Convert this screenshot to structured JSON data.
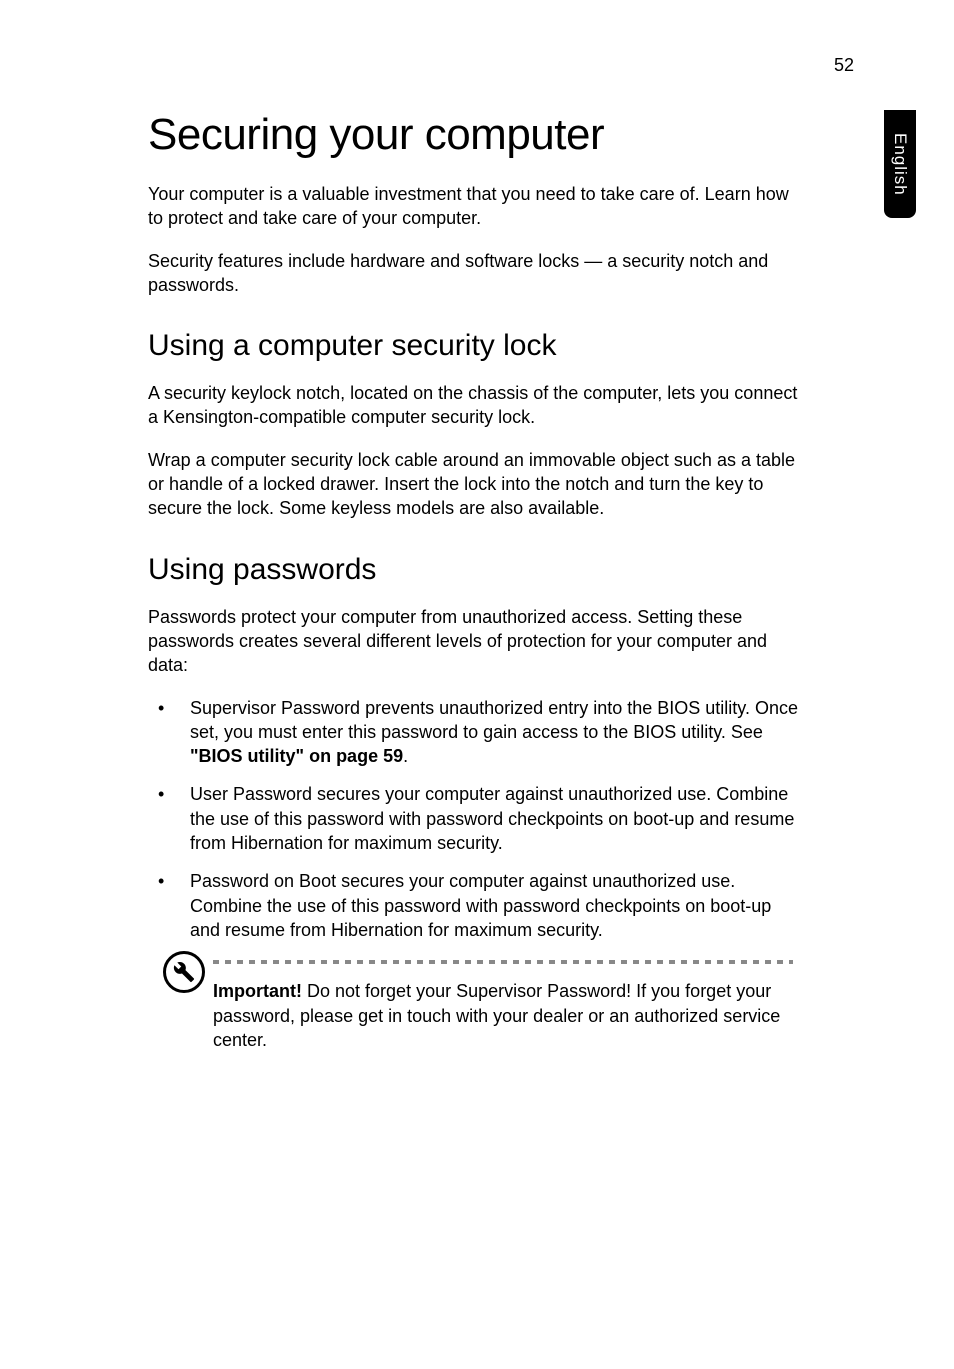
{
  "page_number": "52",
  "side_tab": "English",
  "h1": "Securing your computer",
  "intro_p1": "Your computer is a valuable investment that you need to take care of. Learn how to protect and take care of your computer.",
  "intro_p2": "Security features include hardware and software locks — a security notch and passwords.",
  "h2_1": "Using a computer security lock",
  "section1_p1": "A security keylock notch, located on the chassis of the computer, lets you connect a Kensington-compatible computer security lock.",
  "section1_p2": "Wrap a computer security lock cable around an immovable object such as a table or handle of a locked drawer. Insert the lock into the notch and turn the key to secure the lock. Some keyless models are also available.",
  "h2_2": "Using passwords",
  "section2_p1": "Passwords protect your computer from unauthorized access. Setting these passwords creates several different levels of protection for your computer and data:",
  "bullets": {
    "b1_part1": "Supervisor Password prevents unauthorized entry into the BIOS utility. Once set, you must enter this password to gain access to the BIOS utility. See ",
    "b1_bold": "\"BIOS utility\" on page 59",
    "b1_part2": ".",
    "b2": "User Password secures your computer against unauthorized use. Combine the use of this password with password checkpoints on boot-up and resume from Hibernation for maximum security.",
    "b3": "Password on Boot secures your computer against unauthorized use. Combine the use of this password with password checkpoints on boot-up and resume from Hibernation for maximum security."
  },
  "note_bold": "Important!",
  "note_text": " Do not forget your Supervisor Password! If you forget your password, please get in touch with your dealer or an authorized service center."
}
